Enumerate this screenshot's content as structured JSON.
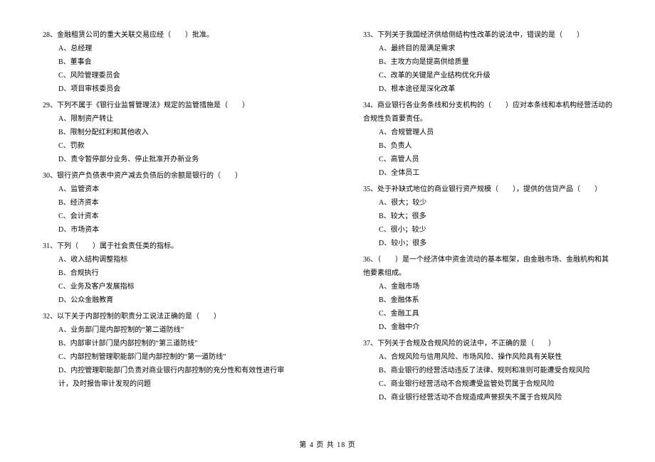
{
  "left": [
    {
      "num": "28",
      "stem": "金融租赁公司的重大关联交易应经（　　）批准。",
      "opts": [
        "A、总经理",
        "B、董事会",
        "C、风险管理委员会",
        "D、项目审核委员会"
      ]
    },
    {
      "num": "29",
      "stem": "下列不属于《银行业监督管理法》规定的监管措施是（　　）",
      "opts": [
        "A、限制资产转让",
        "B、限制分配红利和其他收入",
        "C、罚款",
        "D、责令暂停部分业务、停止批准开办新业务"
      ]
    },
    {
      "num": "30",
      "stem": "银行资产负债表中资产减去负债后的余额是银行的（　　）",
      "opts": [
        "A、监管资本",
        "B、经济资本",
        "C、会计资本",
        "D、市场资本"
      ]
    },
    {
      "num": "31",
      "stem": "下列（　　）属于社会责任类的指标。",
      "opts": [
        "A、收入结构调整指标",
        "B、合规执行",
        "C、业务及客户发展指标",
        "D、公众金融教育"
      ]
    },
    {
      "num": "32",
      "stem": "以下关于内部控制的职责分工说法正确的是（　　）",
      "opts": [
        "A、业务部门是内部控制的“第二道防线”",
        "B、内部审计部门是内部控制的“第三道防线”",
        "C、内部控制管理职能部门是内部控制的“第一道防线”",
        "D、内控管理职能部门负责对商业银行内部控制的充分性和有效性进行审计，及时报告审计发现的问题"
      ]
    }
  ],
  "right": [
    {
      "num": "33",
      "stem": "下列关于我国经济供给侧结构性改革的说法中，错误的是（　　）",
      "opts": [
        "A、最终目的是满足需求",
        "B、主攻方向是提高供给质量",
        "C、改革的关键是产业结构优化升级",
        "D、根本途径是深化改革"
      ]
    },
    {
      "num": "34",
      "stem": "商业银行各业务条线和分支机构的（　　）应对本条线和本机构经营活动的合规性负首要责任。",
      "opts": [
        "A、合规管理人员",
        "B、负责人",
        "C、高管人员",
        "D、全体员工"
      ]
    },
    {
      "num": "35",
      "stem": "处于补缺式地位的商业银行资产规模（　　），提供的信贷产品（　　）",
      "opts": [
        "A、很大；较少",
        "B、较大；很多",
        "C、很小；较少",
        "D、较小；很多"
      ]
    },
    {
      "num": "36",
      "stem": "（　　）是一个经济体中资金流动的基本框架，由金融市场、金融机构和其他要素组成。",
      "opts": [
        "A、金融市场",
        "B、金融体系",
        "C、金融工具",
        "D、金融中介"
      ]
    },
    {
      "num": "37",
      "stem": "下列关于合规及合规风险的说法中，不正确的是（　　）",
      "opts": [
        "A、合规风险与信用风险、市场风险、操作风险具有关联性",
        "B、商业银行的经营活动违反了法律、规则和准则可能遭受合规风险",
        "C、商业银行经营活动不合规遭受监管处罚属于合规风险",
        "D、商业银行经营活动不合规造成声誉损失不属于合规风险"
      ]
    }
  ],
  "footer": "第 4 页 共 18 页"
}
